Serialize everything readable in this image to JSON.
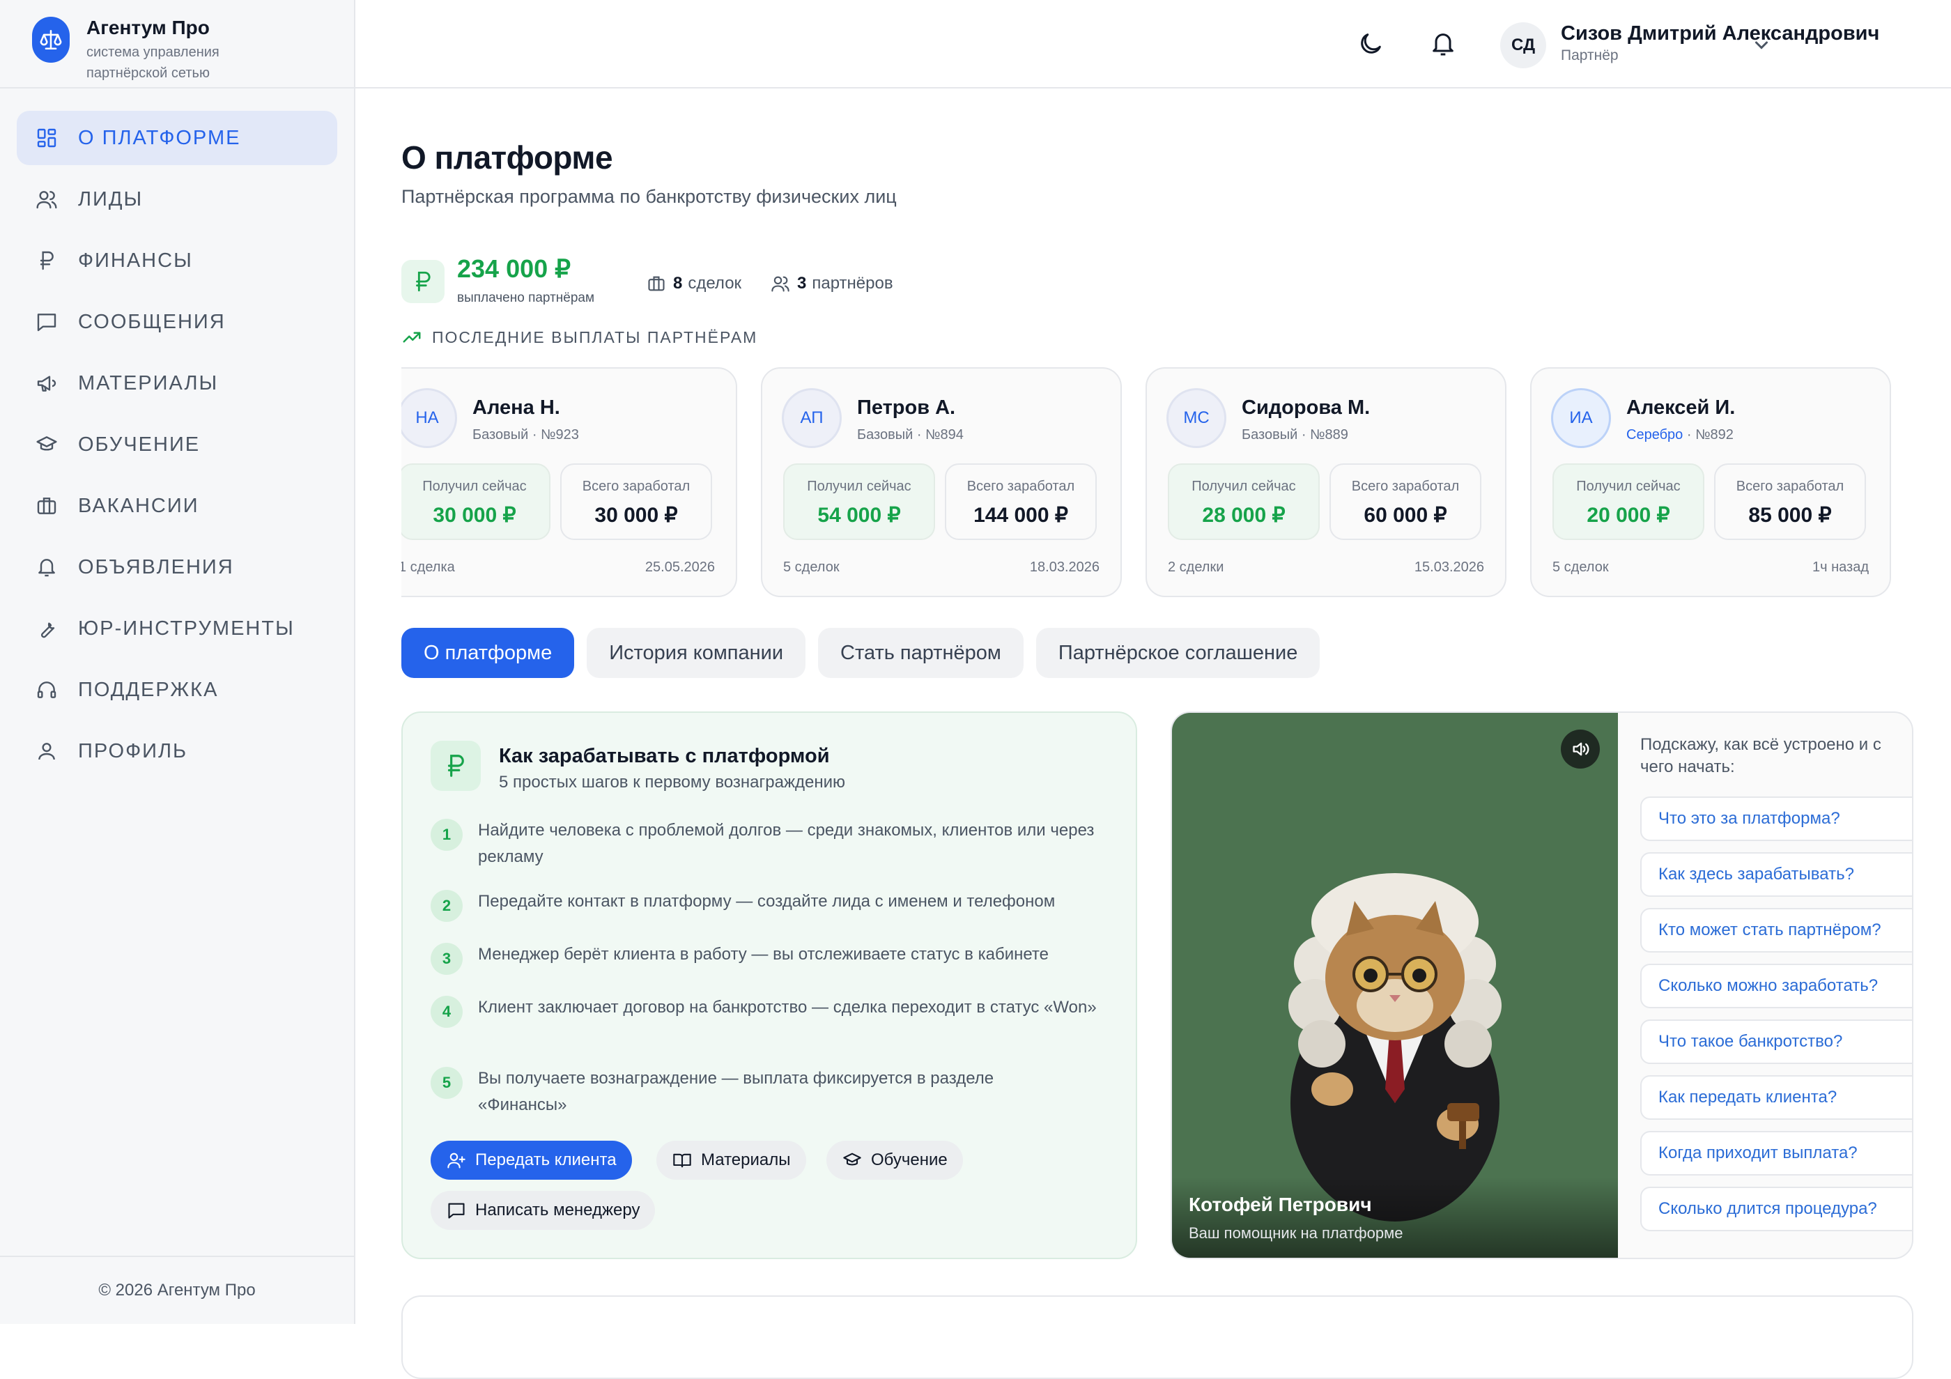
{
  "brand": {
    "title": "Агентум Про",
    "subtitle": "система управления партнёрской сетью"
  },
  "sidebar": {
    "items": [
      {
        "label": "О ПЛАТФОРМЕ",
        "icon": "grid-icon",
        "active": true
      },
      {
        "label": "ЛИДЫ",
        "icon": "users-icon"
      },
      {
        "label": "ФИНАНСЫ",
        "icon": "ruble-icon"
      },
      {
        "label": "СООБЩЕНИЯ",
        "icon": "message-icon"
      },
      {
        "label": "МАТЕРИАЛЫ",
        "icon": "megaphone-icon"
      },
      {
        "label": "ОБУЧЕНИЕ",
        "icon": "graduation-cap-icon"
      },
      {
        "label": "ВАКАНСИИ",
        "icon": "briefcase-icon"
      },
      {
        "label": "ОБЪЯВЛЕНИЯ",
        "icon": "bell-icon"
      },
      {
        "label": "ЮР-ИНСТРУМЕНТЫ",
        "icon": "wrench-icon"
      },
      {
        "label": "ПОДДЕРЖКА",
        "icon": "headphones-icon"
      },
      {
        "label": "ПРОФИЛЬ",
        "icon": "user-icon"
      }
    ],
    "footer": "© 2026 Агентум Про"
  },
  "header": {
    "user_initials": "СД",
    "user_name": "Сизов Дмитрий Александрович",
    "user_role": "Партнёр"
  },
  "page": {
    "title": "О платформе",
    "subtitle": "Партнёрская программа по банкротству физических лиц"
  },
  "stats": {
    "paid_amount": "234 000 ₽",
    "paid_label": "выплачено партнёрам",
    "deals_count": "8",
    "deals_label": "сделок",
    "partners_count": "3",
    "partners_label": "партнёров"
  },
  "payouts": {
    "section_label": "ПОСЛЕДНИЕ ВЫПЛАТЫ ПАРТНЁРАМ",
    "now_label": "Получил сейчас",
    "total_label": "Всего заработал",
    "cards": [
      {
        "initials": "НА",
        "name": "Алена Н.",
        "tier": "Базовый",
        "number": "№923",
        "now": "30 000 ₽",
        "total": "30 000 ₽",
        "deals": "1 сделка",
        "date": "25.05.2026"
      },
      {
        "initials": "АП",
        "name": "Петров А.",
        "tier": "Базовый",
        "number": "№894",
        "now": "54 000 ₽",
        "total": "144 000 ₽",
        "deals": "5 сделок",
        "date": "18.03.2026"
      },
      {
        "initials": "МС",
        "name": "Сидорова М.",
        "tier": "Базовый",
        "number": "№889",
        "now": "28 000 ₽",
        "total": "60 000 ₽",
        "deals": "2 сделки",
        "date": "15.03.2026"
      },
      {
        "initials": "ИА",
        "name": "Алексей И.",
        "tier": "Серебро",
        "number": "№892",
        "now": "20 000 ₽",
        "total": "85 000 ₽",
        "deals": "5 сделок",
        "date": "1ч назад"
      }
    ]
  },
  "tabs": [
    {
      "label": "О платформе",
      "active": true
    },
    {
      "label": "История компании"
    },
    {
      "label": "Стать партнёром"
    },
    {
      "label": "Партнёрское соглашение"
    }
  ],
  "earn": {
    "title": "Как зарабатывать с платформой",
    "subtitle": "5 простых шагов к первому вознаграждению",
    "steps": [
      {
        "n": "1",
        "text": "Найдите человека с проблемой долгов — среди знакомых, клиентов или через рекламу"
      },
      {
        "n": "2",
        "text": "Передайте контакт в платформу — создайте лида с именем и телефоном"
      },
      {
        "n": "3",
        "text": "Менеджер берёт клиента в работу — вы отслеживаете статус в кабинете"
      },
      {
        "n": "4",
        "text": "Клиент заключает договор на банкротство — сделка переходит в статус «Won»"
      },
      {
        "n": "5",
        "text": "Вы получаете вознаграждение — выплата фиксируется в разделе «Финансы»"
      }
    ],
    "buttons": {
      "refer": "Передать клиента",
      "materials": "Материалы",
      "training": "Обучение",
      "write_manager": "Написать менеджеру"
    }
  },
  "assistant": {
    "name": "Котофей Петрович",
    "subtitle": "Ваш помощник на платформе",
    "intro": "Подскажу, как всё устроено и с чего начать:",
    "questions": [
      "Что это за платформа?",
      "Как здесь зарабатывать?",
      "Кто может стать партнёром?",
      "Сколько можно заработать?",
      "Что такое банкротство?",
      "Как передать клиента?",
      "Когда приходит выплата?",
      "Сколько длится процедура?"
    ]
  },
  "colors": {
    "accent": "#2563eb",
    "success": "#16a34a",
    "video_bg": "#4c7350"
  }
}
